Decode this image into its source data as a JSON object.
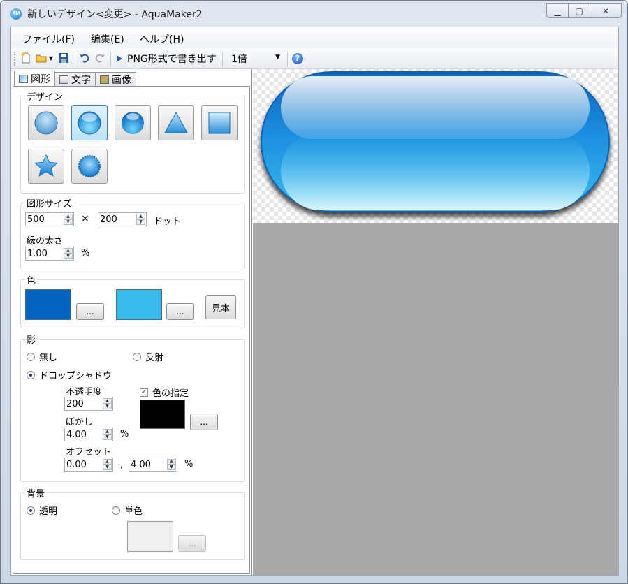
{
  "window": {
    "title": "新しいデザイン<変更> - AquaMaker2",
    "app_icon_text": "AM"
  },
  "menu": {
    "file": "ファイル(F)",
    "edit": "編集(E)",
    "help": "ヘルプ(H)"
  },
  "toolbar": {
    "export_label": "PNG形式で書き出す",
    "zoom_value": "1倍",
    "help_glyph": "?"
  },
  "tabs": {
    "shape": "図形",
    "text": "文字",
    "image": "画像"
  },
  "design": {
    "label": "デザイン",
    "shapes": [
      "circle-flat",
      "circle-glossy-selected",
      "sphere",
      "triangle",
      "square",
      "star",
      "seal"
    ]
  },
  "size": {
    "label": "図形サイズ",
    "width": "500",
    "times": "×",
    "height": "200",
    "unit": "ドット",
    "border_label": "縁の太さ",
    "border_value": "1.00",
    "border_unit": "%"
  },
  "color": {
    "label": "色",
    "color1": "#0064c0",
    "color2": "#39bbed",
    "browse": "...",
    "sample_button": "見本"
  },
  "shadow": {
    "label": "影",
    "none": "無し",
    "reflect": "反射",
    "dropshadow": "ドロップシャドウ",
    "opacity_label": "不透明度",
    "opacity_value": "200",
    "color_check_label": "色の指定",
    "shadow_color": "#000000",
    "blur_label": "ぼかし",
    "blur_value": "4.00",
    "blur_unit": "%",
    "offset_label": "オフセット",
    "offset_x": "0.00",
    "offset_sep": ",",
    "offset_y": "4.00",
    "offset_unit": "%",
    "browse": "..."
  },
  "background": {
    "label": "背景",
    "transparent": "透明",
    "solid": "単色",
    "solid_color": "#f0f0f0",
    "browse": "..."
  },
  "preview": {
    "outer_color": "#0a63b8",
    "inner_color": "#39bbed"
  }
}
